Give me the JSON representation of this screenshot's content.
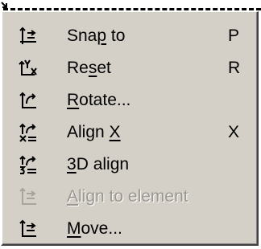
{
  "menu": {
    "items": [
      {
        "name": "snap-to",
        "icon": "snap-to-icon",
        "pre": "Sna",
        "mn": "p",
        "post": " to",
        "accel": "P",
        "enabled": true
      },
      {
        "name": "reset",
        "icon": "reset-axes-icon",
        "pre": "Re",
        "mn": "s",
        "post": "et",
        "accel": "R",
        "enabled": true
      },
      {
        "name": "rotate",
        "icon": "rotate-icon",
        "pre": "",
        "mn": "R",
        "post": "otate...",
        "accel": "",
        "enabled": true
      },
      {
        "name": "align-x",
        "icon": "align-x-icon",
        "pre": "Align ",
        "mn": "X",
        "post": "",
        "accel": "X",
        "enabled": true
      },
      {
        "name": "3d-align",
        "icon": "3d-align-icon",
        "pre": "",
        "mn": "3",
        "post": "D align",
        "accel": "",
        "enabled": true
      },
      {
        "name": "align-to-element",
        "icon": "align-to-element-icon",
        "pre": "",
        "mn": "A",
        "post": "lign to element",
        "accel": "",
        "enabled": false
      },
      {
        "name": "move",
        "icon": "move-icon",
        "pre": "",
        "mn": "M",
        "post": "ove...",
        "accel": "",
        "enabled": true
      }
    ]
  }
}
